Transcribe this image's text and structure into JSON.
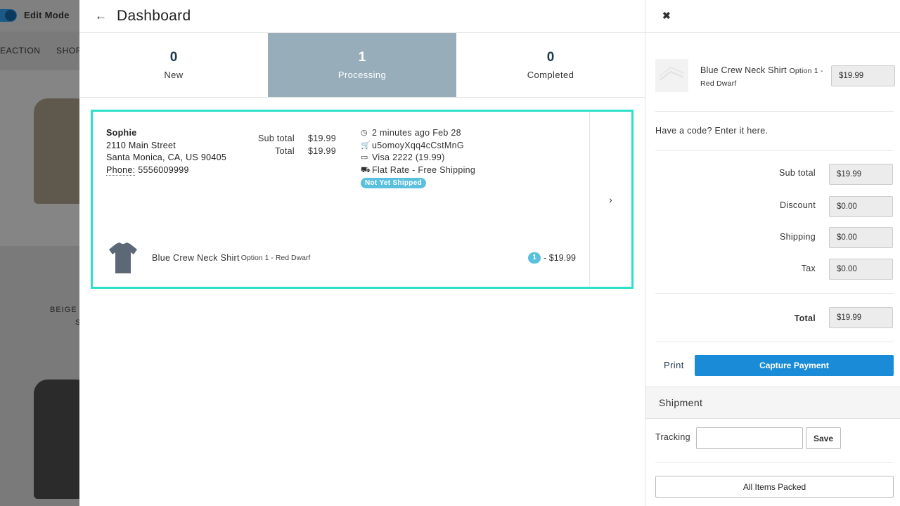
{
  "background": {
    "edit_mode_label": "Edit Mode",
    "nav_items": [
      "EACTION",
      "SHOR"
    ],
    "product_caption_1": "BEIGE",
    "product_caption_2": "S"
  },
  "dashboard": {
    "title": "Dashboard",
    "back_icon": "arrow-left-icon",
    "tabs": [
      {
        "count": "0",
        "label": "New"
      },
      {
        "count": "1",
        "label": "Processing"
      },
      {
        "count": "0",
        "label": "Completed"
      }
    ],
    "order": {
      "customer": {
        "name": "Sophie",
        "street": "2110 Main Street",
        "city_line": "Santa Monica, CA, US 90405",
        "phone_label": "Phone:",
        "phone": "5556009999"
      },
      "subtotal_label": "Sub total",
      "subtotal": "$19.99",
      "total_label": "Total",
      "total": "$19.99",
      "time": "2 minutes ago Feb 28",
      "order_id": "u5omoyXqq4cCstMnG",
      "payment": "Visa 2222 (19.99)",
      "shipping_method": "Flat Rate - Free Shipping",
      "status_badge": "Not Yet Shipped",
      "item": {
        "name": "Blue Crew Neck Shirt",
        "option": "Option 1 - Red Dwarf",
        "quantity": "1",
        "price": "- $19.99"
      }
    }
  },
  "panel": {
    "item": {
      "name": "Blue Crew Neck Shirt",
      "option_a": "Option 1 -",
      "option_b": "Red Dwarf",
      "price": "$19.99"
    },
    "code_link": "Have a code? Enter it here.",
    "summary": {
      "subtotal_label": "Sub total",
      "subtotal": "$19.99",
      "discount_label": "Discount",
      "discount": "$0.00",
      "shipping_label": "Shipping",
      "shipping": "$0.00",
      "tax_label": "Tax",
      "tax": "$0.00",
      "total_label": "Total",
      "total": "$19.99"
    },
    "print_label": "Print",
    "capture_label": "Capture Payment",
    "shipment_title": "Shipment",
    "tracking_label": "Tracking",
    "tracking_value": "",
    "save_label": "Save",
    "packed_label": "All Items Packed"
  },
  "colors": {
    "accent_border": "#2de0c8",
    "tab_active": "#97adba",
    "primary_button": "#1a8bd6",
    "badge": "#5bc0de"
  }
}
